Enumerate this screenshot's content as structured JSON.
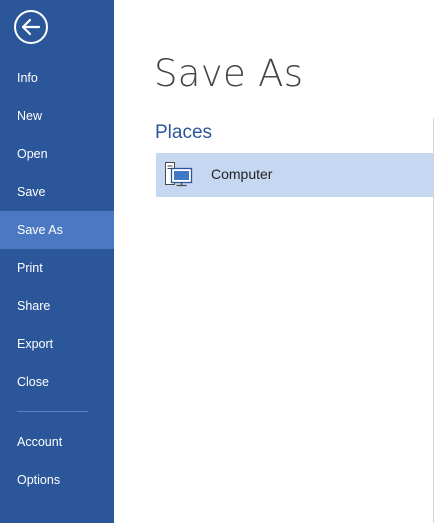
{
  "nav": {
    "back_icon": "back-arrow-icon",
    "items": [
      {
        "label": "Info",
        "selected": false
      },
      {
        "label": "New",
        "selected": false
      },
      {
        "label": "Open",
        "selected": false
      },
      {
        "label": "Save",
        "selected": false
      },
      {
        "label": "Save As",
        "selected": true
      },
      {
        "label": "Print",
        "selected": false
      },
      {
        "label": "Share",
        "selected": false
      },
      {
        "label": "Export",
        "selected": false
      },
      {
        "label": "Close",
        "selected": false
      }
    ],
    "bottom_items": [
      {
        "label": "Account"
      },
      {
        "label": "Options"
      }
    ]
  },
  "main": {
    "title": "Save As",
    "places_header": "Places",
    "places": [
      {
        "label": "Computer",
        "icon": "computer-icon",
        "selected": true
      }
    ]
  },
  "colors": {
    "nav_background": "#2b579a",
    "nav_selected": "#4a78c2",
    "place_selected": "#c5d7f1",
    "accent_text": "#2b579a"
  }
}
